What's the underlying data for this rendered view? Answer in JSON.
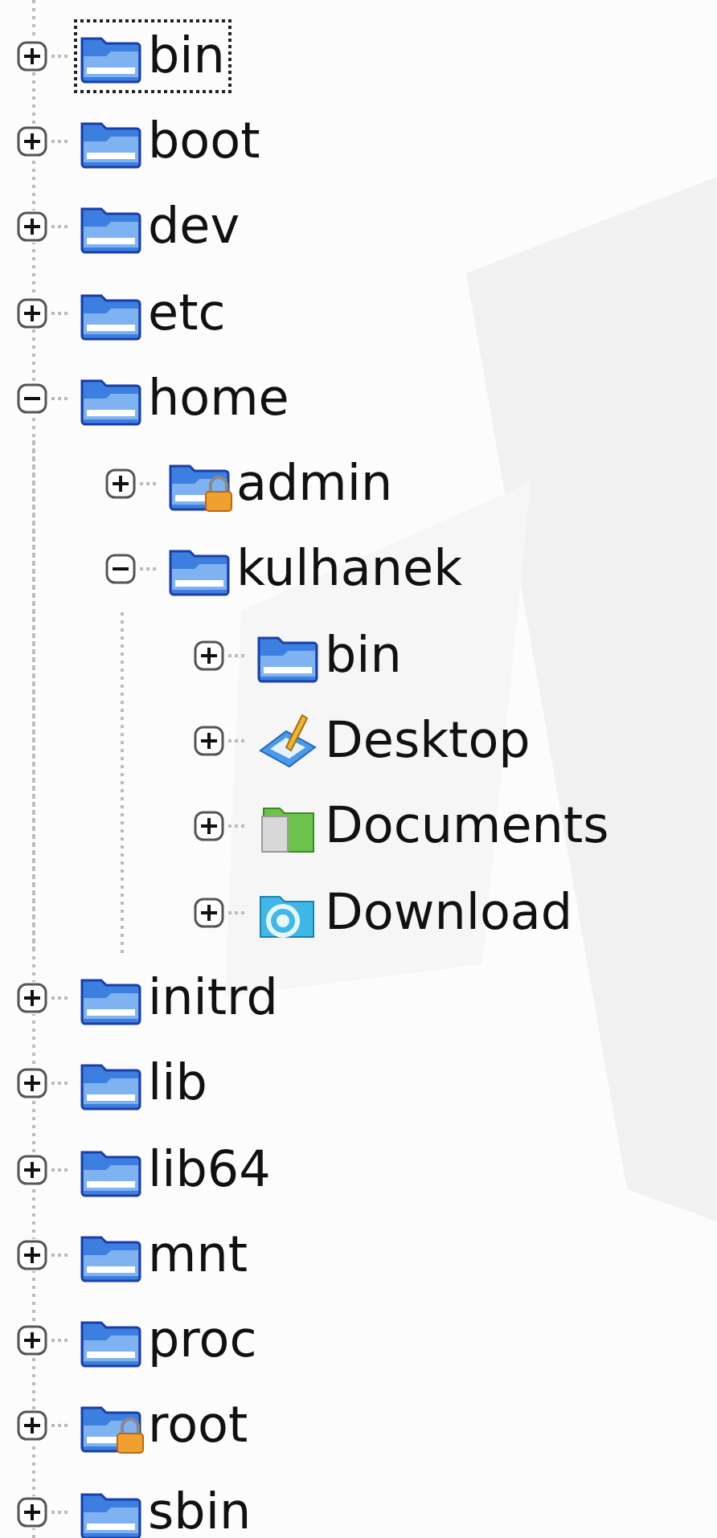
{
  "tree": [
    {
      "name": "bin",
      "kind": "folder",
      "expanded": false,
      "selected": true
    },
    {
      "name": "boot",
      "kind": "folder",
      "expanded": false,
      "selected": false
    },
    {
      "name": "dev",
      "kind": "folder",
      "expanded": false,
      "selected": false
    },
    {
      "name": "etc",
      "kind": "folder",
      "expanded": false,
      "selected": false
    },
    {
      "name": "home",
      "kind": "folder",
      "expanded": true,
      "selected": false,
      "children": [
        {
          "name": "admin",
          "kind": "locked-folder",
          "expanded": false,
          "selected": false
        },
        {
          "name": "kulhanek",
          "kind": "folder",
          "expanded": true,
          "selected": false,
          "children": [
            {
              "name": "bin",
              "kind": "folder",
              "expanded": false,
              "selected": false
            },
            {
              "name": "Desktop",
              "kind": "desktop",
              "expanded": false,
              "selected": false
            },
            {
              "name": "Documents",
              "kind": "documents",
              "expanded": false,
              "selected": false
            },
            {
              "name": "Download",
              "kind": "download",
              "expanded": false,
              "selected": false
            }
          ]
        }
      ]
    },
    {
      "name": "initrd",
      "kind": "folder",
      "expanded": false,
      "selected": false
    },
    {
      "name": "lib",
      "kind": "folder",
      "expanded": false,
      "selected": false
    },
    {
      "name": "lib64",
      "kind": "folder",
      "expanded": false,
      "selected": false
    },
    {
      "name": "mnt",
      "kind": "folder",
      "expanded": false,
      "selected": false
    },
    {
      "name": "proc",
      "kind": "folder",
      "expanded": false,
      "selected": false
    },
    {
      "name": "root",
      "kind": "locked-folder",
      "expanded": false,
      "selected": false
    },
    {
      "name": "sbin",
      "kind": "folder",
      "expanded": false,
      "selected": false
    }
  ]
}
